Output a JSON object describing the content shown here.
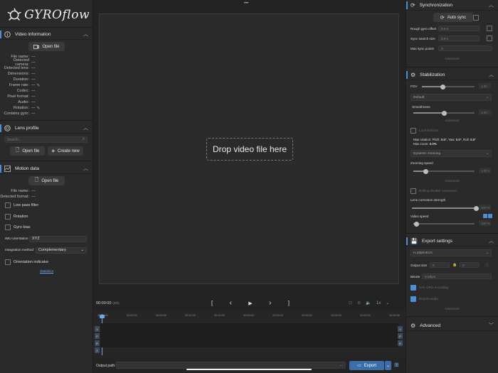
{
  "app": {
    "logo_text": "GYROflow",
    "menu_dots": "•••"
  },
  "video_info": {
    "title": "Video information",
    "open_file": "Open file",
    "fields": [
      {
        "label": "File name:",
        "value": "---"
      },
      {
        "label": "Detected camera:",
        "value": "---"
      },
      {
        "label": "Detected lens:",
        "value": "---"
      },
      {
        "label": "Dimensions:",
        "value": "---"
      },
      {
        "label": "Duration:",
        "value": "---"
      },
      {
        "label": "Frame rate:",
        "value": "---"
      },
      {
        "label": "Codec:",
        "value": "---"
      },
      {
        "label": "Pixel format:",
        "value": "---"
      },
      {
        "label": "Audio:",
        "value": "---"
      },
      {
        "label": "Rotation:",
        "value": "---"
      },
      {
        "label": "Contains gyro:",
        "value": "---"
      }
    ]
  },
  "lens_profile": {
    "title": "Lens profile",
    "search_placeholder": "Search...",
    "open_file": "Open file",
    "create_new": "Create new"
  },
  "motion_data": {
    "title": "Motion data",
    "open_file": "Open file",
    "fields": [
      {
        "label": "File name:",
        "value": "---"
      },
      {
        "label": "Detected format:",
        "value": "---"
      }
    ],
    "low_pass": "Low pass filter",
    "rotation": "Rotation",
    "gyro_bias": "Gyro bias",
    "imu_label": "IMU orientation",
    "imu_value": "XYZ",
    "integration_label": "Integration method",
    "integration_value": "Complementary",
    "orientation_indicator": "Orientation indicator",
    "statistics": "Statistics"
  },
  "drop_text": "Drop video file here",
  "playback": {
    "time": "00:00:00",
    "frame": "(0/0)",
    "speed": "1x",
    "bracket_left": "[",
    "bracket_right": "]",
    "prev": "‹",
    "play": "▶",
    "next": "›",
    "ticks": [
      "00:00:00",
      "00:00:00",
      "00:00:00",
      "00:00:00",
      "00:00:00",
      "00:00:00",
      "00:00:00",
      "00:00:00",
      "00:00:00",
      "00:00:00",
      "00:00:00"
    ],
    "left_axes": [
      "Y",
      "P",
      "R",
      "Z"
    ],
    "right_axes": [
      "Y",
      "P",
      "R"
    ]
  },
  "output": {
    "label": "Output path:",
    "browse": "...",
    "export": "Export"
  },
  "sync": {
    "title": "Synchronization",
    "auto_sync": "Auto sync",
    "rough_offset_label": "Rough gyro offset",
    "rough_offset_value": "0.0 s",
    "search_size_label": "Sync search size",
    "search_size_value": "5.0 s",
    "max_points_label": "Max sync points",
    "max_points_value": "3",
    "advanced": "Advanced"
  },
  "stabilization": {
    "title": "Stabilization",
    "fov_label": "FOV",
    "fov_value": "1.00",
    "fov_level": 0.4,
    "method": "Default",
    "smoothness_label": "Smoothness",
    "smoothness_value": "1.00",
    "smoothness_level": 0.5,
    "advanced": "Advanced",
    "lock_horizon": "Lock horizon",
    "max_rotation_label": "Max rotation: Pitch:",
    "pitch": "0.0°",
    "yaw_label": ", Yaw:",
    "yaw": "0.0°",
    "roll_label": ", Roll:",
    "roll": "0.0°",
    "max_zoom_label": "Max zoom:",
    "max_zoom": "0.0%",
    "zoom_mode": "Dynamic zooming",
    "zooming_speed_label": "Zooming speed",
    "zooming_speed_value": "1.00 s",
    "zooming_speed_level": 0.2,
    "advanced2": "Advanced",
    "rolling_shutter": "Rolling shutter correction",
    "lens_strength_label": "Lens correction strength",
    "lens_strength_value": "100 %",
    "lens_strength_level": 1.0,
    "video_speed_label": "Video speed",
    "video_speed_value": "100 %",
    "video_speed_level": 0.05
  },
  "export": {
    "title": "Export settings",
    "codec": "H.265/HEVC",
    "output_size_label": "Output size",
    "width": "0",
    "height": "0",
    "bitrate_label": "Bitrate",
    "bitrate_value": "0 Mbps",
    "gpu": "Use GPU encoding",
    "audio": "Export audio",
    "advanced": "Advanced"
  },
  "advanced_section": {
    "title": "Advanced"
  },
  "colors": {
    "accent": "#4a8fd9",
    "panel": "#2a2a2a",
    "background": "#1e1e1e"
  }
}
